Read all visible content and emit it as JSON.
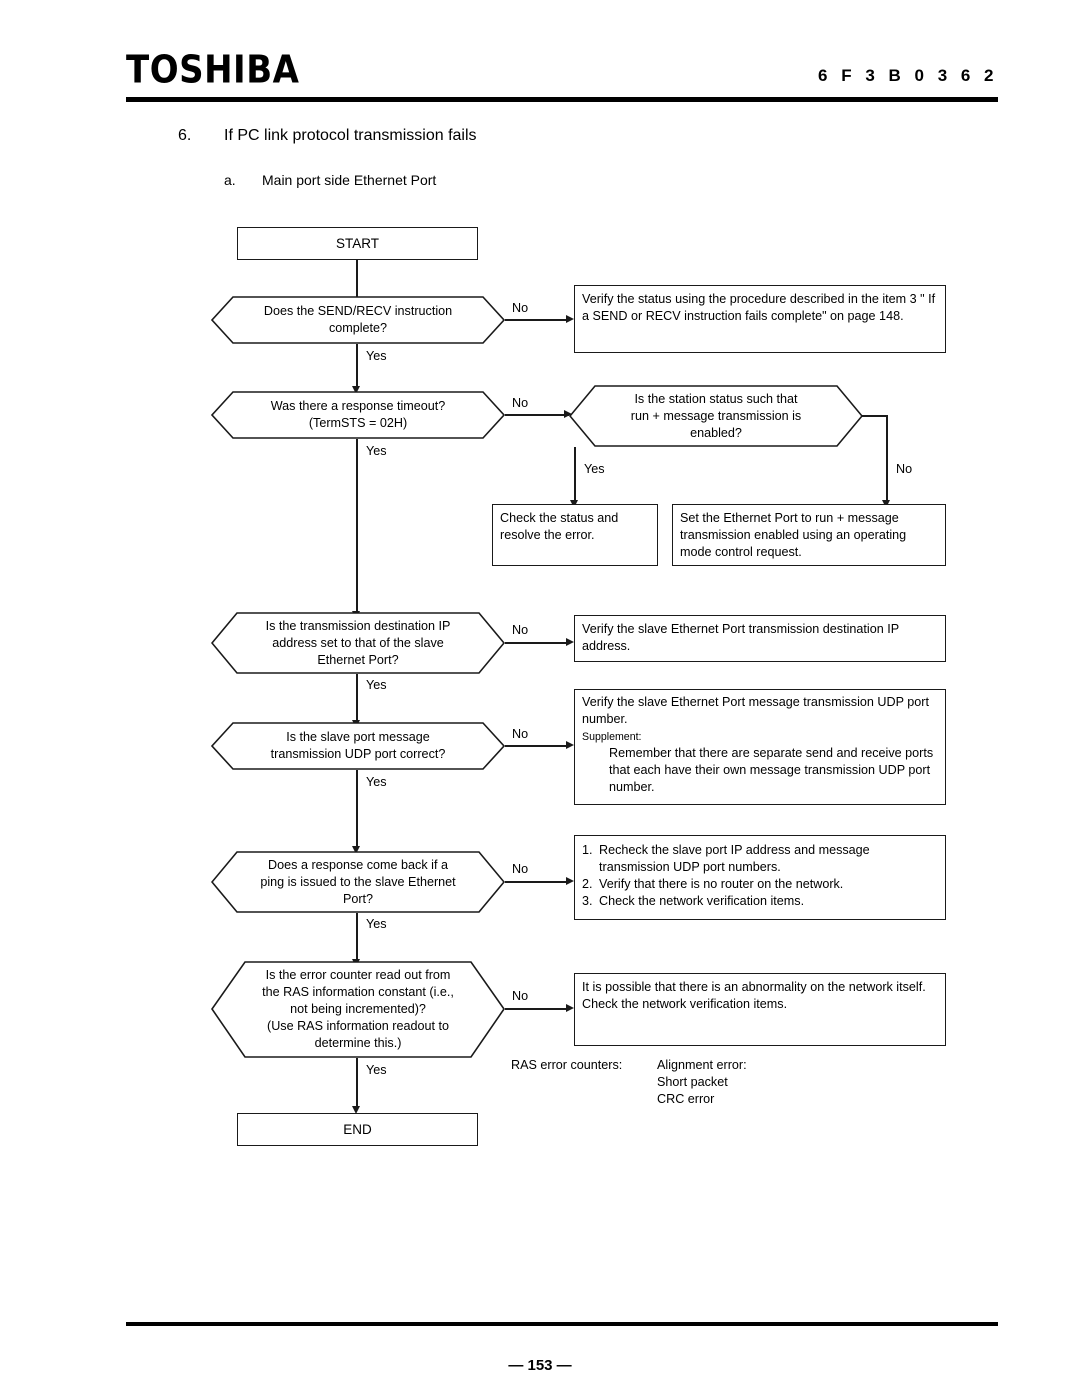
{
  "header": {
    "brand": "TOSHIBA",
    "doc_code": "6 F 3 B 0 3 6 2"
  },
  "titles": {
    "section_number": "6.",
    "section_title": "If PC link protocol transmission fails",
    "subsection_number": "a.",
    "subsection_title": "Main port side Ethernet Port"
  },
  "footer": {
    "page_number": "— 153 —"
  },
  "flowchart": {
    "start_label": "START",
    "end_label": "END",
    "yes_label": "Yes",
    "no_label": "No",
    "decisions": {
      "send_recv": {
        "line1": "Does the SEND/RECV instruction",
        "line2": "complete?"
      },
      "timeout": {
        "line1": "Was there a response timeout?",
        "line2": "(TermSTS = 02H)"
      },
      "station_status": {
        "line1": "Is the station status such that",
        "line2": "run + message transmission is",
        "line3": "enabled?"
      },
      "dest_ip": {
        "line1": "Is the transmission destination IP",
        "line2": "address set to that of the slave",
        "line3": "Ethernet Port?"
      },
      "udp_port": {
        "line1": "Is the slave port message",
        "line2": "transmission UDP port correct?"
      },
      "ping": {
        "line1": "Does a response come back if a",
        "line2": "ping is issued to the slave Ethernet",
        "line3": "Port?"
      },
      "ras_counter": {
        "line1": "Is the error counter read out from",
        "line2": "the RAS information constant (i.e.,",
        "line3": "not being incremented)?",
        "line4": "(Use RAS information readout to",
        "line5": "determine this.)"
      }
    },
    "actions": {
      "verify_status": "Verify the status using the procedure described in the item 3 \" If a SEND or RECV instruction fails complete\" on page 148.",
      "check_status": "Check the status and resolve the error.",
      "set_ethernet_port": "Set the Ethernet Port to run + message transmission enabled using an operating mode control request.",
      "verify_dest_ip": "Verify the slave Ethernet Port transmission destination IP address.",
      "verify_udp_main": "Verify the slave Ethernet Port message transmission UDP port number.",
      "verify_udp_supp_head": "Supplement:",
      "verify_udp_supp_body": "Remember that there are separate send and receive ports that each have their own message transmission UDP port number.",
      "ping_fail_1_num": "1.",
      "ping_fail_1": "Recheck the slave port IP address and message transmission UDP port numbers.",
      "ping_fail_2_num": "2.",
      "ping_fail_2": "Verify that there is no router on the network.",
      "ping_fail_3_num": "3.",
      "ping_fail_3": "Check the network verification items.",
      "network_abnormal": "It is possible that there is an abnormality on the network itself. Check the network verification items."
    },
    "ras_note": {
      "label": "RAS error counters:",
      "items_1": "Alignment error:",
      "items_2": "Short packet",
      "items_3": "CRC error"
    }
  }
}
